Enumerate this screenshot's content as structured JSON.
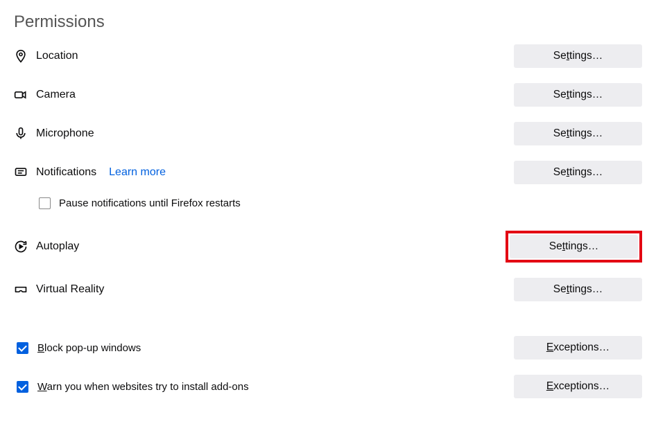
{
  "section_title": "Permissions",
  "settings_button": "Settings…",
  "exceptions_button": "Exceptions…",
  "learn_more": "Learn more",
  "items": {
    "location": {
      "label": "Location"
    },
    "camera": {
      "label": "Camera"
    },
    "microphone": {
      "label": "Microphone"
    },
    "notifications": {
      "label": "Notifications"
    },
    "autoplay": {
      "label": "Autoplay"
    },
    "vr": {
      "label": "Virtual Reality"
    }
  },
  "pause_notifications": {
    "label_before": "Pause ",
    "label_ul": "n",
    "label_after": "otifications until Firefox restarts",
    "checked": false
  },
  "block_popups": {
    "label_ul": "B",
    "label_after": "lock pop-up windows",
    "checked": true
  },
  "warn_addons": {
    "label_ul": "W",
    "label_after": "arn you when websites try to install add-ons",
    "checked": true
  },
  "highlight_autoplay": true
}
